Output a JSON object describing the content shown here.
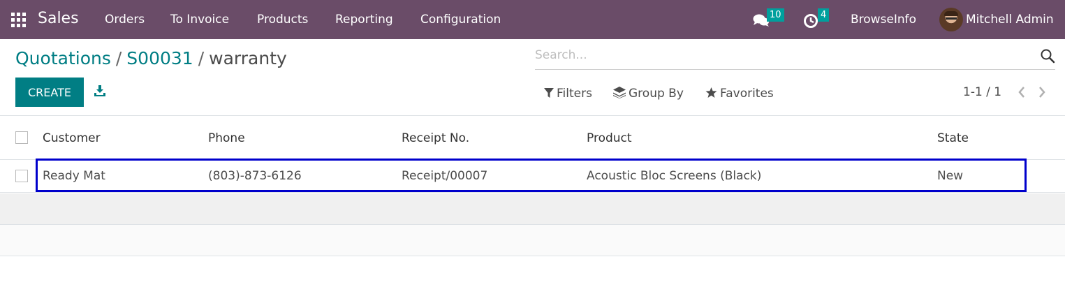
{
  "navbar": {
    "app_name": "Sales",
    "menus": [
      "Orders",
      "To Invoice",
      "Products",
      "Reporting",
      "Configuration"
    ],
    "messages_count": "10",
    "activities_count": "4",
    "company": "BrowseInfo",
    "user": "Mitchell Admin",
    "icons": [
      "apps-grid-icon",
      "chat-icon",
      "clock-icon",
      "avatar"
    ],
    "color": "#6a4c68"
  },
  "breadcrumb": {
    "items": [
      "Quotations",
      "S00031"
    ],
    "separator": "/",
    "current": "warranty"
  },
  "search": {
    "placeholder": "Search..."
  },
  "toolbar": {
    "create_label": "CREATE"
  },
  "filters": {
    "filters_label": "Filters",
    "group_by_label": "Group By",
    "favorites_label": "Favorites"
  },
  "pager": {
    "value": "1-1 / 1"
  },
  "table": {
    "columns": [
      "Customer",
      "Phone",
      "Receipt No.",
      "Product",
      "State"
    ],
    "rows": [
      {
        "customer": "Ready Mat",
        "phone": "(803)-873-6126",
        "receipt": "Receipt/00007",
        "product": "Acoustic Bloc Screens (Black)",
        "state": "New"
      }
    ]
  },
  "colors": {
    "accent": "#017e84",
    "badge": "#00a09d",
    "highlight": "#0000cc"
  }
}
